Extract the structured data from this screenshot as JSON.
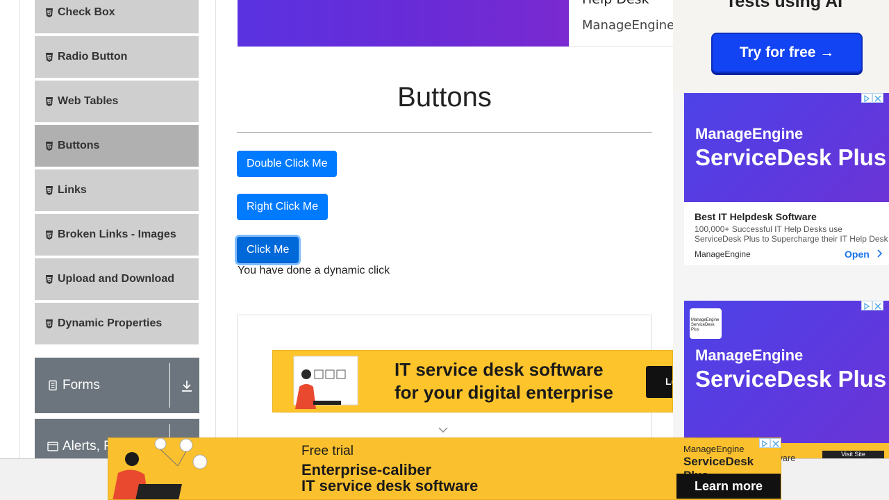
{
  "sidebar": {
    "items": [
      {
        "label": "Check Box",
        "icon": "html5-icon"
      },
      {
        "label": "Radio Button",
        "icon": "html5-icon"
      },
      {
        "label": "Web Tables",
        "icon": "html5-icon"
      },
      {
        "label": "Buttons",
        "icon": "html5-icon",
        "active": true
      },
      {
        "label": "Links",
        "icon": "html5-icon"
      },
      {
        "label": "Broken Links - Images",
        "icon": "html5-icon"
      },
      {
        "label": "Upload and Download",
        "icon": "html5-icon"
      },
      {
        "label": "Dynamic Properties",
        "icon": "html5-icon"
      }
    ],
    "groups": [
      {
        "label": "Forms",
        "icon": "document-icon"
      },
      {
        "label": "Alerts, F",
        "icon": "window-icon"
      }
    ]
  },
  "top_banner": {
    "title": "Help Desk",
    "brand": "ManageEngine"
  },
  "main": {
    "title": "Buttons",
    "double_click_label": "Double Click Me",
    "right_click_label": "Right Click Me",
    "click_label": "Click Me",
    "dynamic_message": "You have done a dynamic click"
  },
  "inline_ad": {
    "line1": "IT service desk software",
    "line2": "for your digital enterprise",
    "button": "Le"
  },
  "right_ads": {
    "try_heading": "Tests using AI",
    "try_button": "Try for free →",
    "sd_brand": "ManageEngine",
    "sd_product": "ServiceDesk Plus",
    "card_title": "Best IT Helpdesk Software",
    "card_desc": "100,000+ Successful IT Help Desks use ServiceDesk Plus to Supercharge their IT Help Desk",
    "card_brand": "ManageEngine",
    "card_open": "Open",
    "sd2_logo_text": "ManageEngine ServiceDesk Plus",
    "sd2_cta_text": "ftware",
    "sd2_cta_btn": "Visit Site"
  },
  "bottom_ad": {
    "line1": "Free trial",
    "line2": "Enterprise-caliber",
    "line3": "IT service desk software",
    "brand1": "ManageEngine",
    "brand2": "ServiceDesk Plus",
    "learn_more": "Learn more"
  },
  "colors": {
    "primary_button": "#007bff",
    "sidebar_item": "#cfcfcf",
    "sidebar_active": "#b0b0b0",
    "group_header": "#6c757d",
    "ad_yellow": "#fbc02d",
    "ad_purple": "#5a3ae0"
  }
}
